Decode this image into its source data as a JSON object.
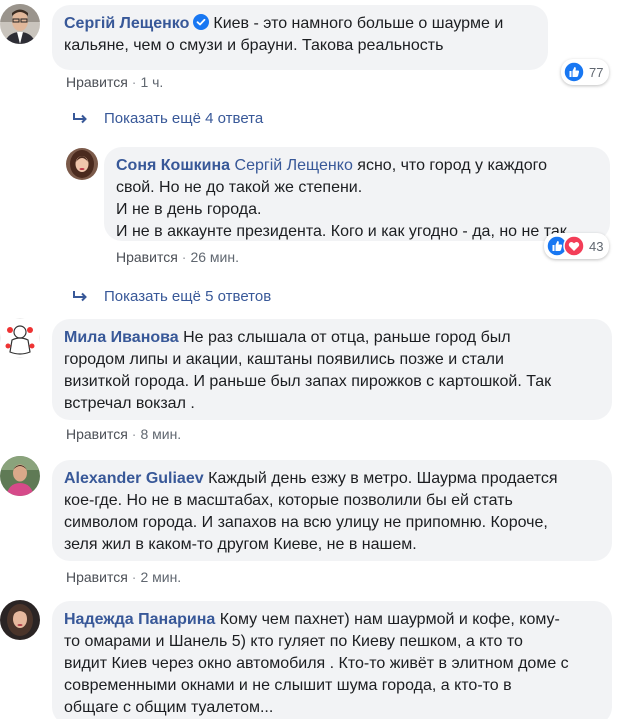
{
  "comments": [
    {
      "author": "Сергій Лещенко",
      "verified": true,
      "lines": [
        "Киев - это намного больше о шаурме и",
        "кальяне, чем о смузи и брауни. Такова реальность"
      ],
      "like_label": "Нравится",
      "time": "1 ч.",
      "reaction_count": "77"
    },
    {
      "author": "Соня Кошкина",
      "mention": "Сергій Лещенко",
      "first_line_rest": "ясно, что город у каждого",
      "lines": [
        "свой. Но не до такой же степени.",
        "И не в день города.",
        "И не в аккаунте президента. Кого и как угодно - да, но не так"
      ],
      "like_label": "Нравится",
      "time": "26 мин.",
      "reaction_count": "43"
    },
    {
      "author": "Мила Иванова",
      "first_line_rest": "Не раз слышала от отца, раньше город был",
      "lines": [
        "городом липы и акации, каштаны появились позже и стали",
        "визиткой города. И раньше был запах пирожков с картошкой. Так",
        "встречал вокзал ."
      ],
      "like_label": "Нравится",
      "time": "8 мин."
    },
    {
      "author": "Alexander Guliaev",
      "first_line_rest": "Каждый день езжу в метро. Шаурма продается",
      "lines": [
        "кое-где. Но не в масштабах, которые позволили бы ей стать",
        "символом города. И запахов на всю улицу не припомню. Короче,",
        "зеля жил в каком-то другом Киеве, не в нашем."
      ],
      "like_label": "Нравится",
      "time": "2 мин."
    },
    {
      "author": "Надежда Панарина",
      "first_line_rest": "Кому чем пахнет) нам шаурмой и кофе, кому-",
      "lines": [
        "то омарами и Шанель 5) кто гуляет по Киеву пешком, а кто то",
        "видит Киев через окно автомобиля . Кто-то живёт в элитном доме с",
        "современными окнами и не слышит шума города, а кто-то в",
        "общаге с общим туалетом..."
      ]
    }
  ],
  "more_replies": [
    "Показать ещё 4 ответа",
    "Показать ещё 5 ответов"
  ],
  "colors": {
    "link": "#385898",
    "bubble": "#f2f3f5",
    "like_blue": "#1877f2",
    "love_red": "#f33e58"
  },
  "icons": [
    "verified-badge-icon",
    "reply-arrow-icon",
    "like-reaction-icon",
    "love-reaction-icon"
  ]
}
